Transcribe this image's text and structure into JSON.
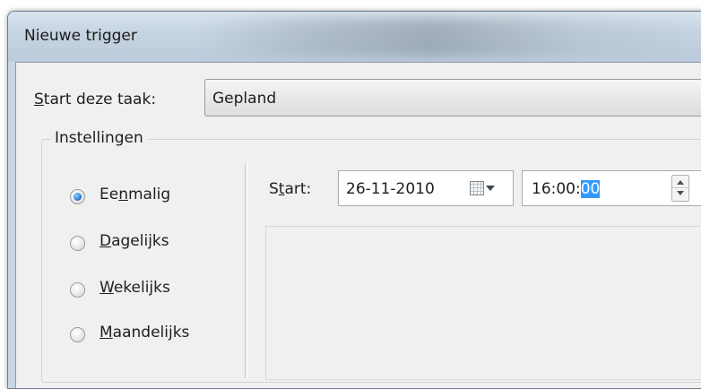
{
  "window": {
    "title": "Nieuwe trigger"
  },
  "start_task": {
    "label_accel": "S",
    "label_rest": "tart deze taak:",
    "value": "Gepland"
  },
  "settings": {
    "legend": "Instellingen",
    "schedule_options": [
      {
        "pre": "Ee",
        "accel": "n",
        "post": "malig",
        "selected": true
      },
      {
        "pre": "",
        "accel": "D",
        "post": "agelijks",
        "selected": false
      },
      {
        "pre": "",
        "accel": "W",
        "post": "ekelijks",
        "selected": false
      },
      {
        "pre": "",
        "accel": "M",
        "post": "aandelijks",
        "selected": false
      }
    ],
    "start": {
      "label_pre": "S",
      "label_accel": "t",
      "label_post": "art:",
      "date": "26-11-2010",
      "time_prefix": "16:00:",
      "time_selected": "00"
    }
  },
  "icons": {
    "calendar": "calendar-icon",
    "dropdown": "chevron-down-icon",
    "spinner_up": "spin-up-icon",
    "spinner_down": "spin-down-icon"
  },
  "colors": {
    "selection": "#3399ff",
    "radio_selected": "#2f7fd0"
  }
}
